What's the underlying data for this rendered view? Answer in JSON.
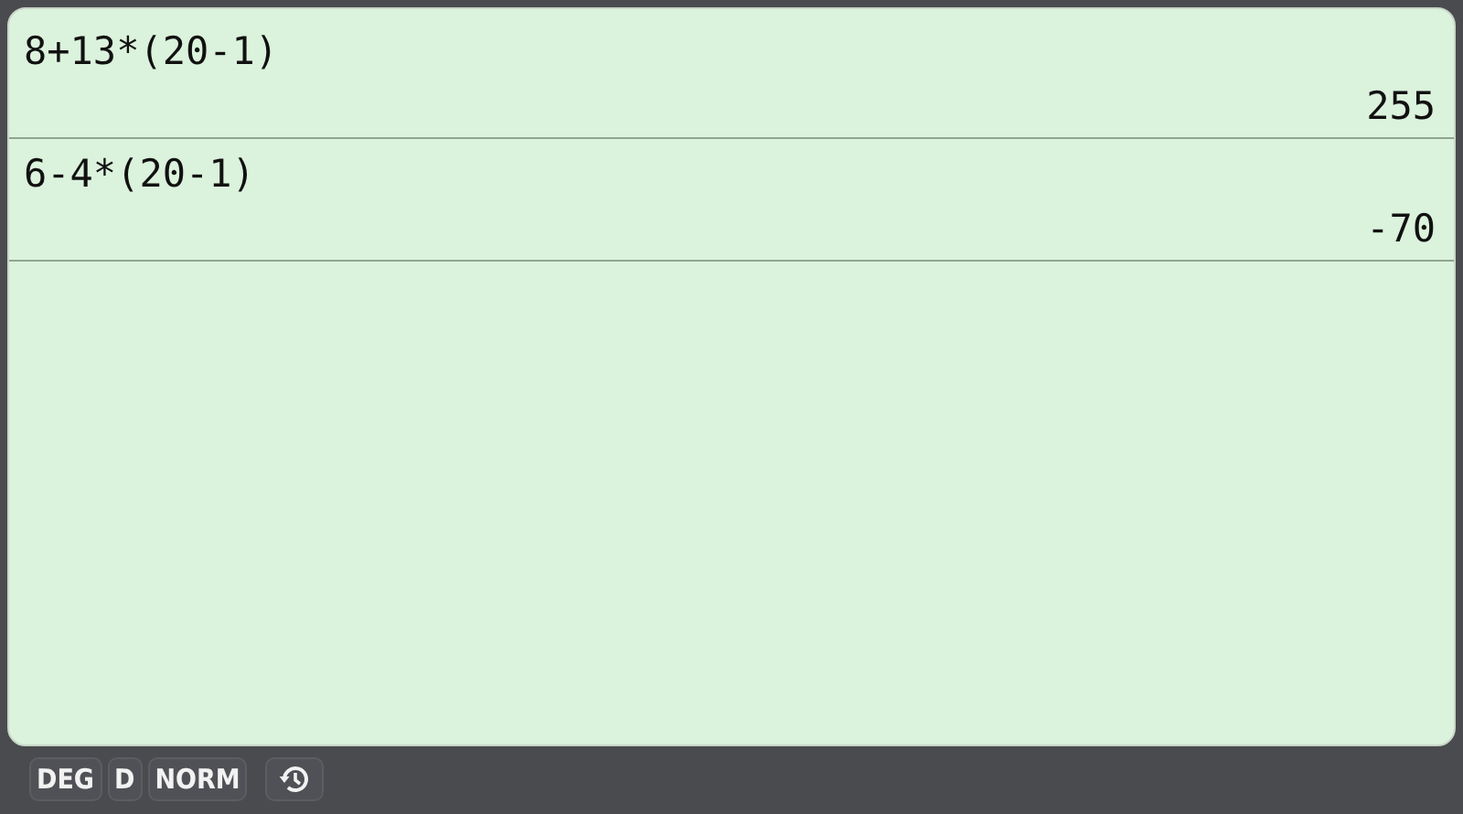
{
  "history": [
    {
      "expression": "8+13*(20-1)",
      "result": "255"
    },
    {
      "expression": "6-4*(20-1)",
      "result": "-70"
    }
  ],
  "status_bar": {
    "indicators": [
      "DEG",
      "D",
      "NORM"
    ]
  }
}
